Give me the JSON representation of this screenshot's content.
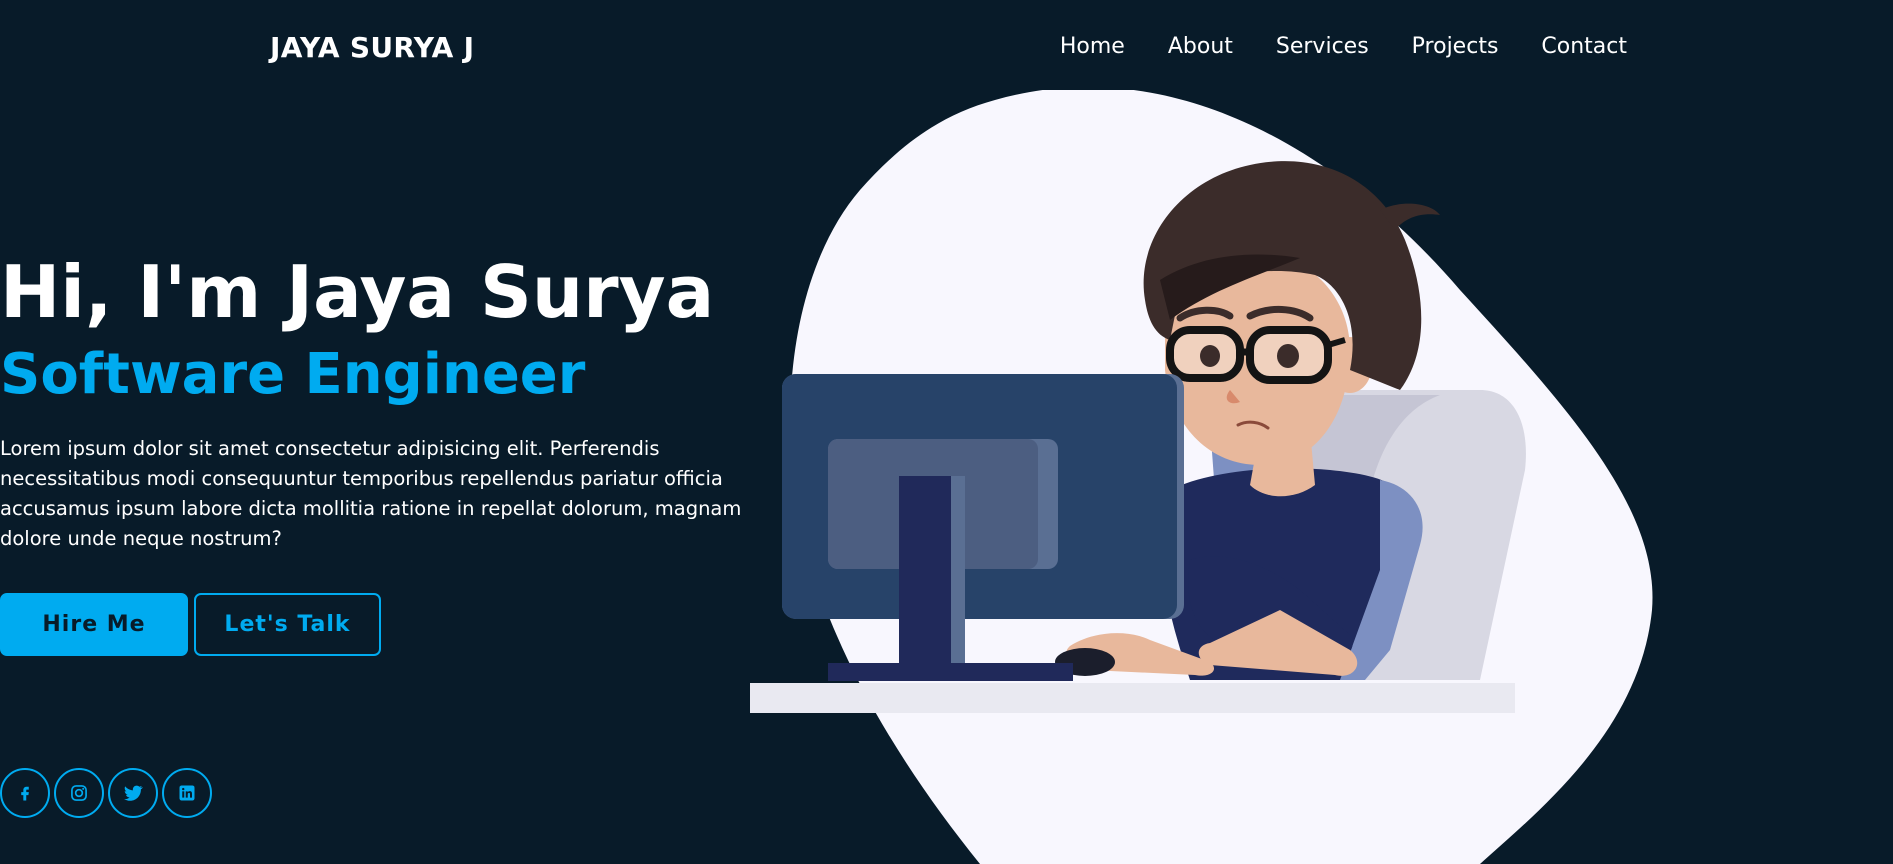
{
  "header": {
    "logo": "JAYA SURYA J",
    "nav": [
      "Home",
      "About",
      "Services",
      "Projects",
      "Contact"
    ]
  },
  "hero": {
    "greeting": "Hi, I'm Jaya Surya",
    "role": "Software Engineer",
    "description": "Lorem ipsum dolor sit amet consectetur adipisicing elit. Perferendis necessitatibus modi consequuntur temporibus repellendus pariatur officia accusamus ipsum labore dicta mollitia ratione in repellat dolorum, magnam dolore unde neque nostrum?",
    "buttons": {
      "primary": "Hire Me",
      "secondary": "Let's Talk"
    }
  },
  "socials": [
    "facebook-icon",
    "instagram-icon",
    "twitter-icon",
    "linkedin-icon"
  ],
  "colors": {
    "background": "#081b29",
    "accent": "#00abf0",
    "text": "#ffffff"
  }
}
